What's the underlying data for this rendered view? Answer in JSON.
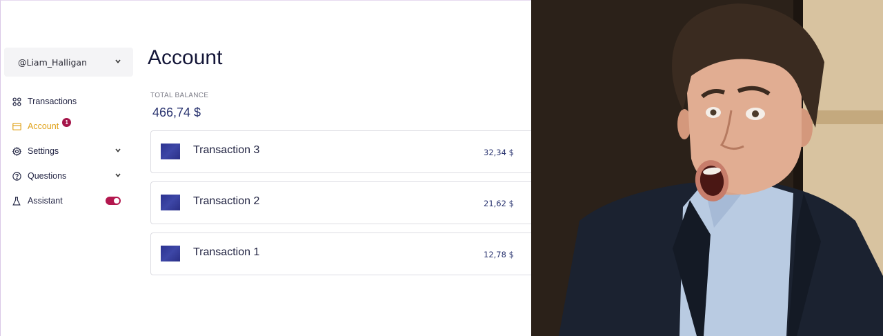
{
  "user": {
    "handle": "@Liam_Halligan"
  },
  "nav": {
    "items": [
      {
        "label": "Transactions",
        "icon": "grid-icon"
      },
      {
        "label": "Account",
        "icon": "card-icon",
        "badge": "1",
        "active": true
      },
      {
        "label": "Settings",
        "icon": "gear-icon"
      },
      {
        "label": "Questions",
        "icon": "question-icon"
      },
      {
        "label": "Assistant",
        "icon": "flask-icon",
        "toggle": true
      }
    ]
  },
  "page": {
    "title": "Account"
  },
  "balance": {
    "label": "TOTAL BALANCE",
    "value": "466,74 $"
  },
  "transactions": [
    {
      "name": "Transaction 3",
      "amount": "32,34 $"
    },
    {
      "name": "Transaction 2",
      "amount": "21,62 $"
    },
    {
      "name": "Transaction 1",
      "amount": "12,78 $"
    }
  ],
  "colors": {
    "accent": "#e0a21a",
    "brand": "#b3174e",
    "primary": "#2a3470"
  }
}
